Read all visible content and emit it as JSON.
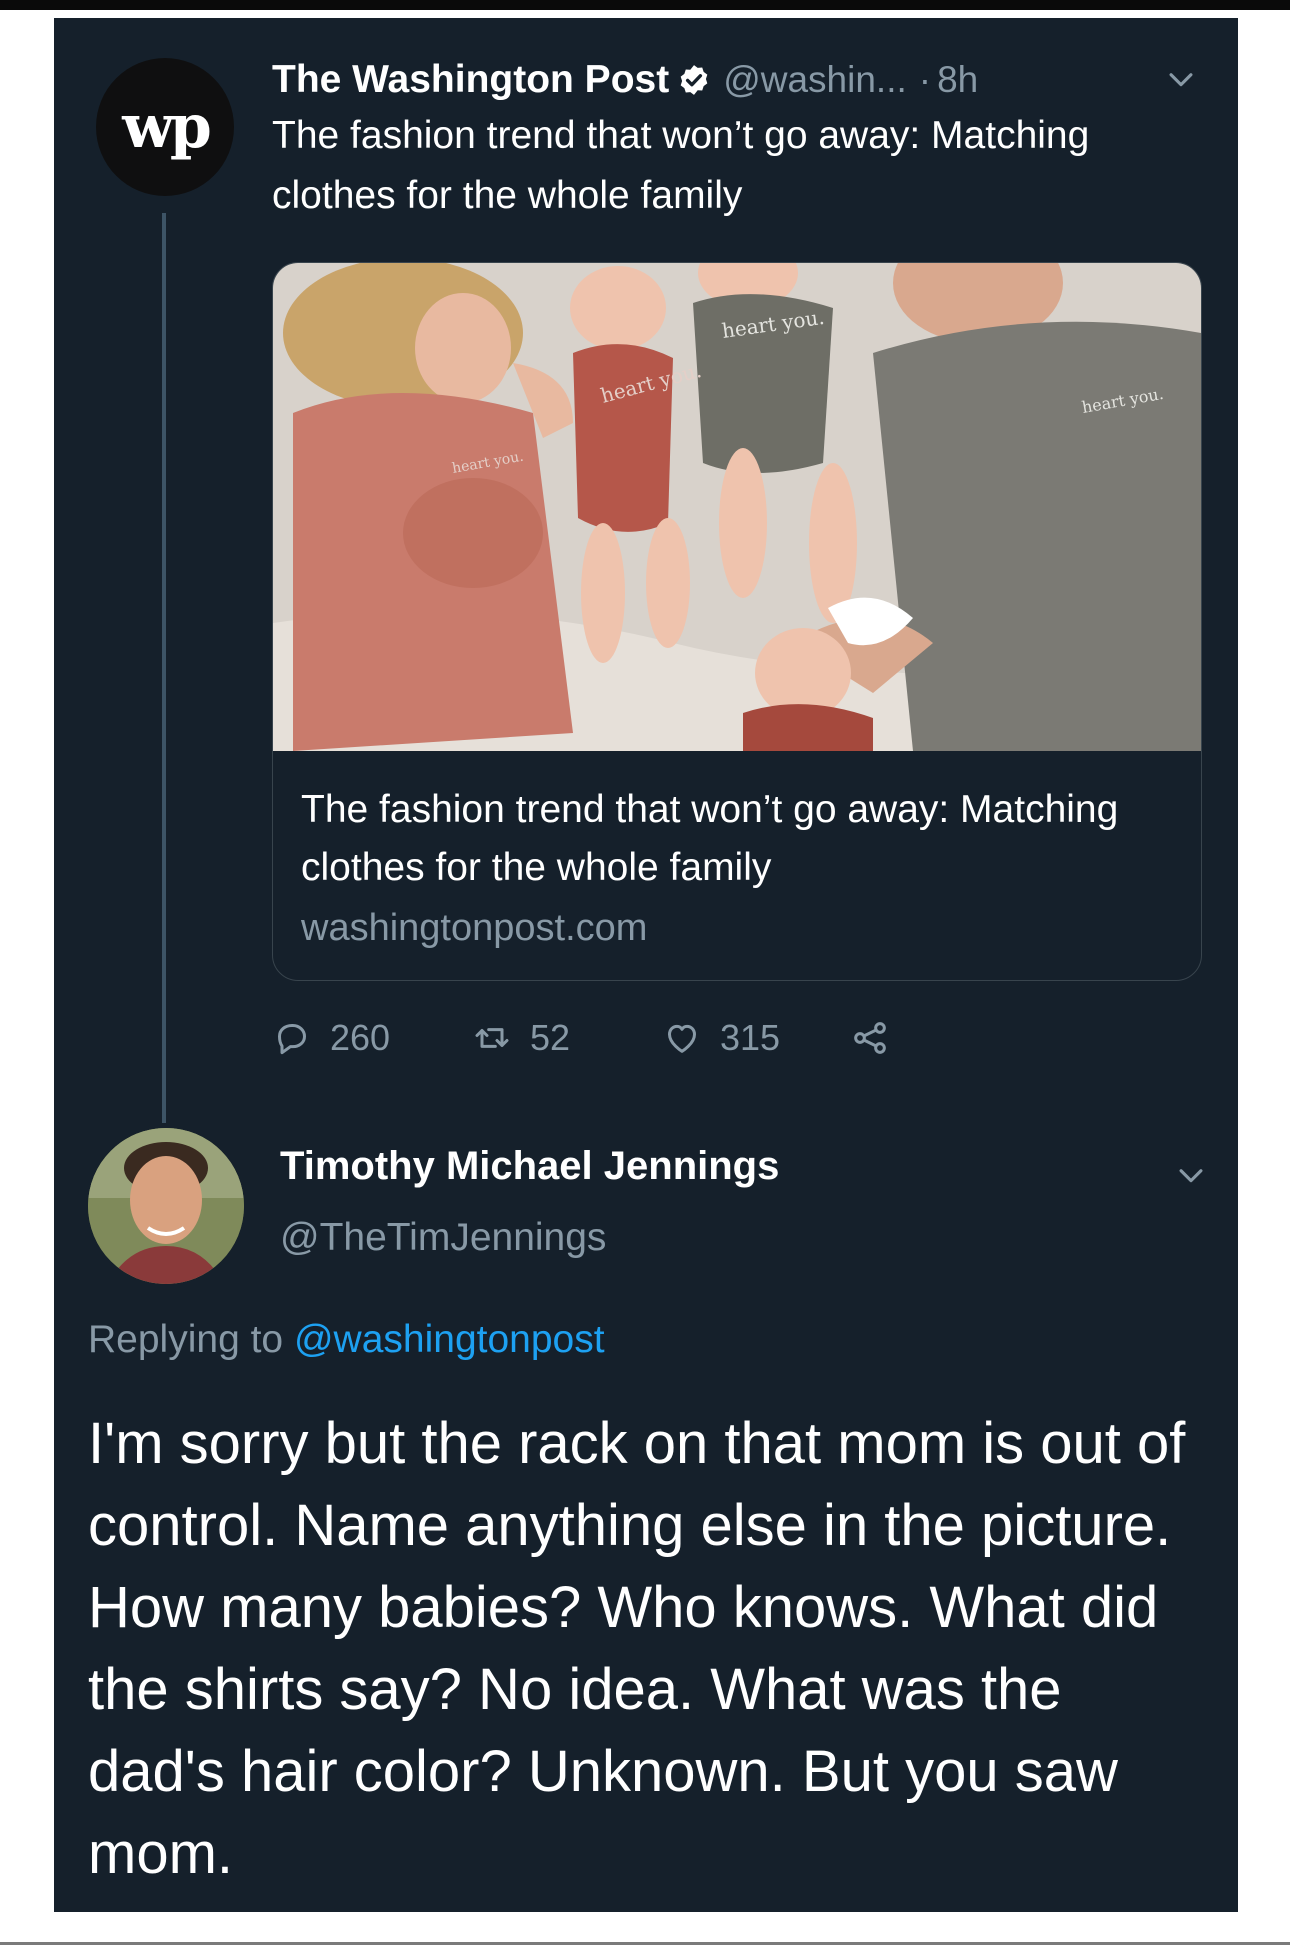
{
  "original_tweet": {
    "avatar_text": "wp",
    "author": "The Washington Post",
    "handle": "@washin...",
    "separator": "·",
    "time": "8h",
    "text": "The fashion trend that won’t go away: Matching clothes for the whole family",
    "card": {
      "shirt_text": "heart you.",
      "title": "The fashion trend that won’t go away: Matching clothes for the whole family",
      "domain": "washingtonpost.com"
    },
    "stats": {
      "replies": "260",
      "retweets": "52",
      "likes": "315"
    }
  },
  "reply": {
    "author": "Timothy Michael Jennings",
    "handle": "@TheTimJennings",
    "replying_prefix": "Replying to",
    "replying_to": "@washingtonpost",
    "text": "I'm sorry but the rack on that mom is out of control. Name anything else in the picture. How many babies? Who knows. What did the shirts say? No idea. What was the dad's hair color? Unknown. But you saw mom."
  },
  "colors": {
    "background": "#15202b",
    "secondary_text": "#8899a6",
    "link": "#1da1f2",
    "verified": "#ffffff"
  },
  "icons": [
    "verified-icon",
    "chevron-down-icon",
    "reply-icon",
    "retweet-icon",
    "like-icon",
    "share-icon"
  ]
}
